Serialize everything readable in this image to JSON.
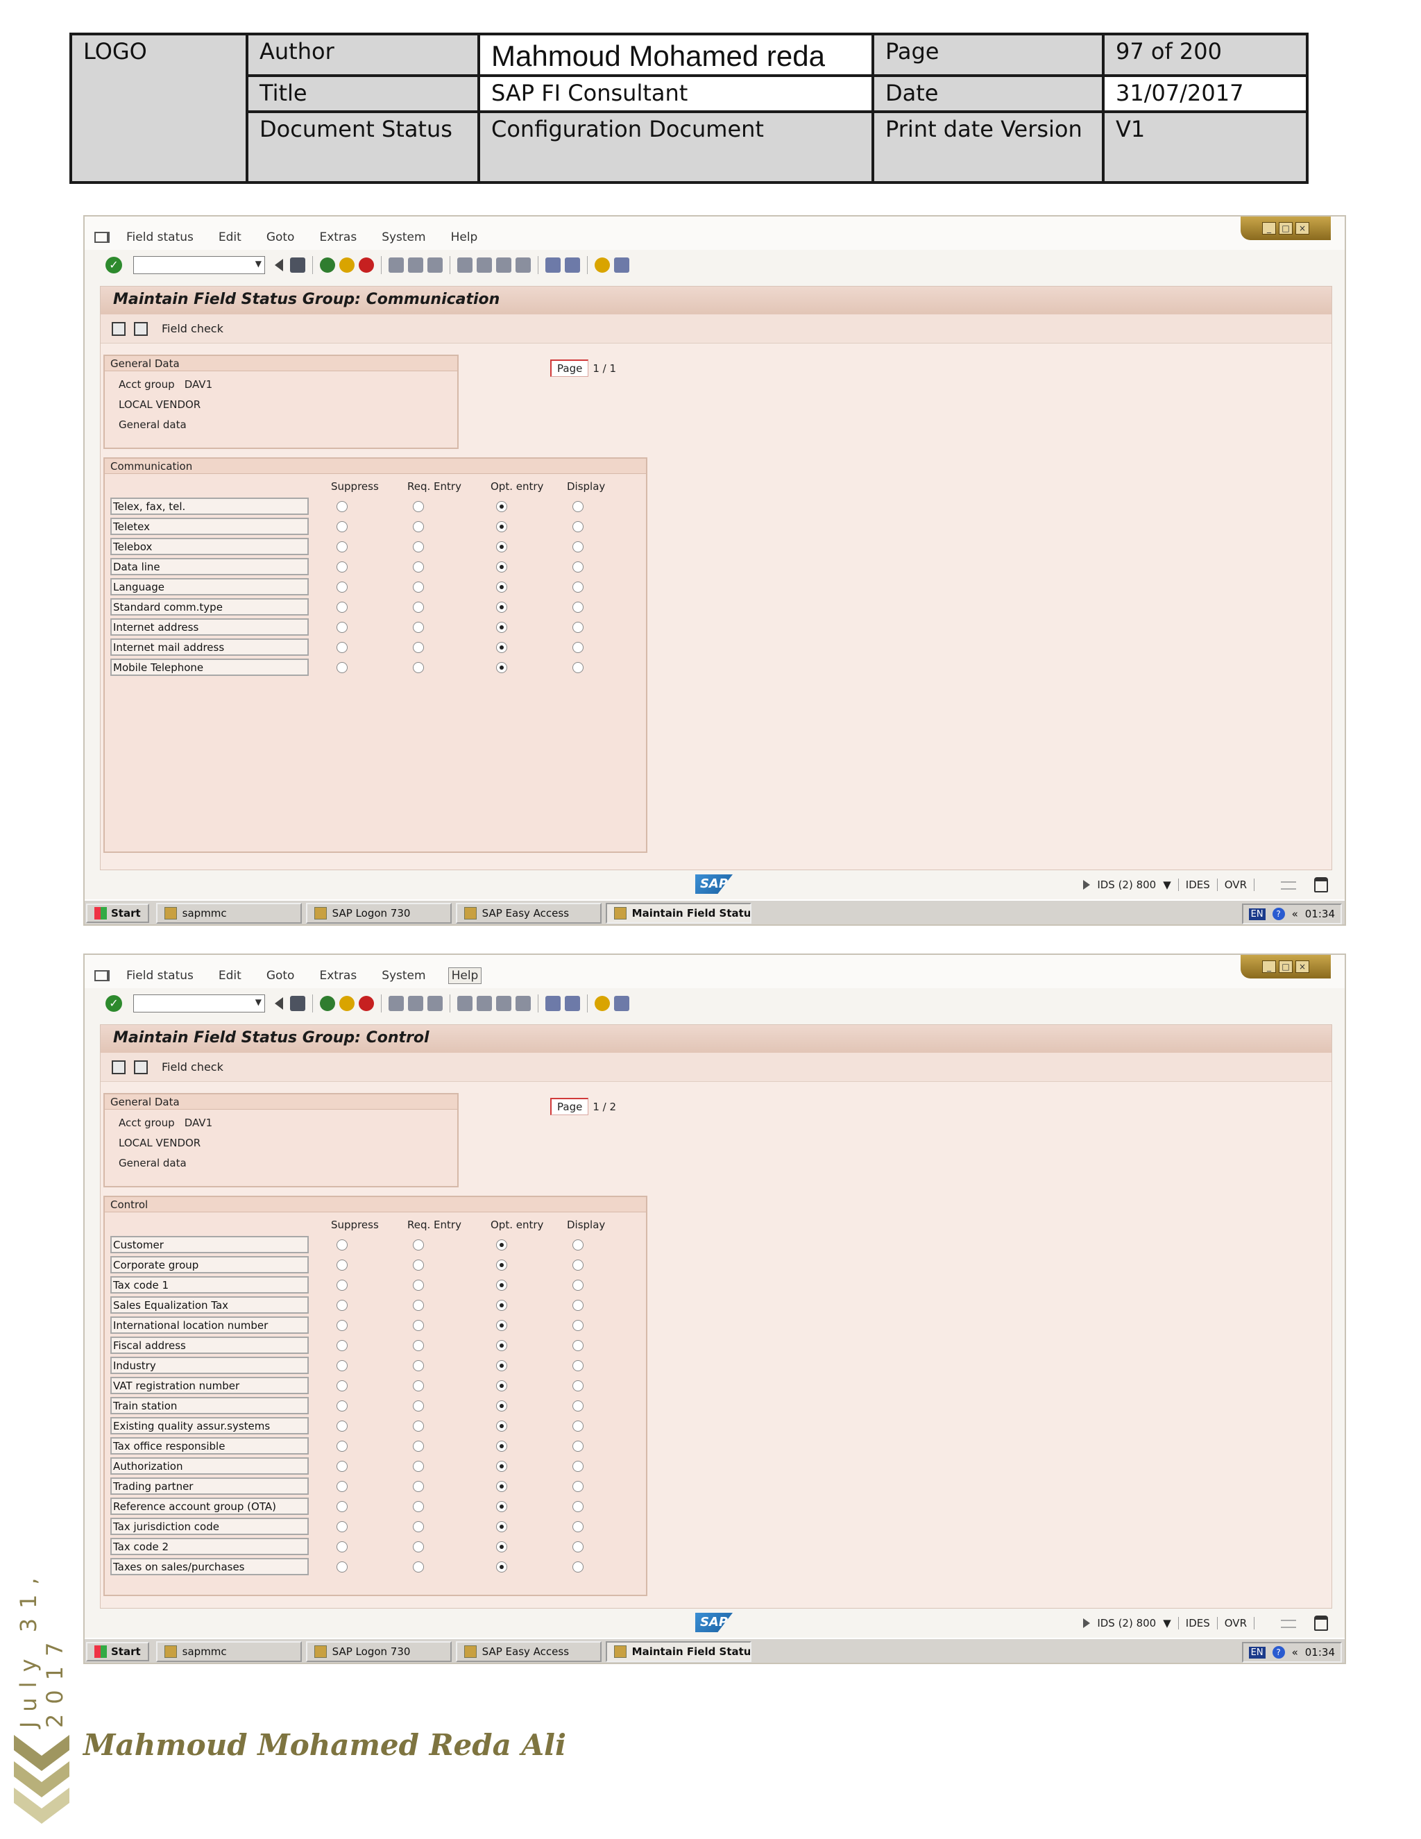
{
  "doc_header": {
    "logo": "LOGO",
    "author_label": "Author",
    "author_value": "Mahmoud Mohamed reda",
    "page_label": "Page",
    "page_value": "97 of 200",
    "title_label": "Title",
    "title_value": "SAP FI Consultant",
    "date_label": "Date",
    "date_value": "31/07/2017",
    "status_label": "Document Status",
    "status_value": "Configuration Document",
    "version_label": "Print date Version",
    "version_value": "V1"
  },
  "sap_common": {
    "menu": [
      "Field status",
      "Edit",
      "Goto",
      "Extras",
      "System",
      "Help"
    ],
    "field_check": "Field check",
    "general_data_head": "General Data",
    "acct_group_label": "Acct group",
    "acct_group_value": "DAV1",
    "vendor_type": "LOCAL VENDOR",
    "general_data_text": "General data",
    "page_btn": "Page",
    "col_suppress": "Suppress",
    "col_req": "Req. Entry",
    "col_opt": "Opt. entry",
    "col_display": "Display",
    "sap_logo": "SAP",
    "system_info": "IDS (2) 800",
    "client": "IDES",
    "mode": "OVR",
    "task_start": "Start",
    "task_1": "sapmmc",
    "task_2": "SAP Logon 730",
    "task_3": "SAP Easy Access",
    "task_4": "Maintain Field Status ...",
    "lang": "EN",
    "clock": "01:34"
  },
  "window1": {
    "title": "Maintain Field Status Group: Communication",
    "page_indicator": "1  /  1",
    "section_head": "Communication",
    "fields": [
      "Telex, fax, tel.",
      "Teletex",
      "Telebox",
      "Data line",
      "Language",
      "Standard comm.type",
      "Internet address",
      "Internet mail address",
      "Mobile Telephone"
    ],
    "selected": "Opt. entry"
  },
  "window2": {
    "title": "Maintain Field Status Group: Control",
    "page_indicator": "1  /  2",
    "section_head": "Control",
    "fields": [
      "Customer",
      "Corporate group",
      "Tax code 1",
      "Sales Equalization Tax",
      "International location number",
      "Fiscal address",
      "Industry",
      "VAT registration number",
      "Train station",
      "Existing quality assur.systems",
      "Tax office responsible",
      "Authorization",
      "Trading partner",
      "Reference account group (OTA)",
      "Tax jurisdiction code",
      "Tax code 2",
      "Taxes on sales/purchases"
    ],
    "selected": "Opt. entry"
  },
  "footer": {
    "side_date": "July 31, 2017",
    "name": "Mahmoud Mohamed Reda Ali",
    "accent_color": "#7e7440"
  }
}
